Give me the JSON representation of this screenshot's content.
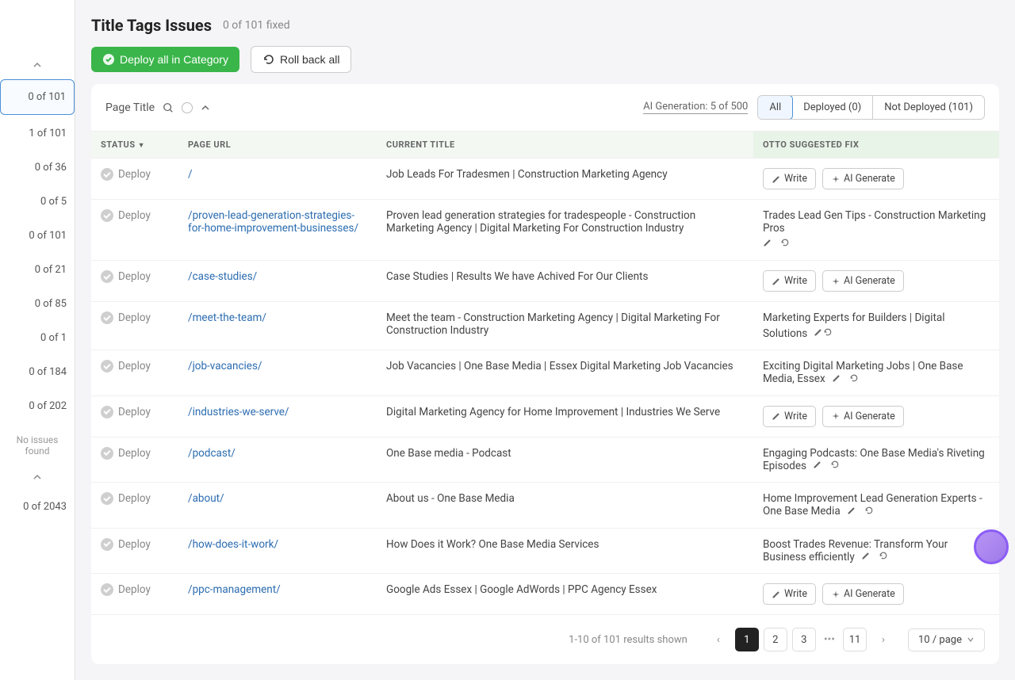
{
  "header": {
    "title": "Title Tags Issues",
    "fixed_text": "0 of 101 fixed",
    "deploy_all": "Deploy all in Category",
    "rollback_all": "Roll back all"
  },
  "filters": {
    "page_title": "Page Title",
    "ai_generation": "AI Generation:  5  of  500",
    "tabs": {
      "all": "All",
      "deployed": "Deployed (0)",
      "not_deployed": "Not Deployed (101)"
    }
  },
  "sidebar": {
    "items": [
      "0 of 101",
      "1 of 101",
      "0 of 36",
      "0 of 5",
      "0 of 101",
      "0 of 21",
      "0 of 85",
      "0 of 1",
      "0 of 184",
      "0 of 202"
    ],
    "no_issues": "No issues found",
    "bottom": "0 of 2043"
  },
  "columns": {
    "status": "STATUS",
    "url": "PAGE URL",
    "current": "CURRENT TITLE",
    "fix": "OTTO SUGGESTED FIX"
  },
  "actions": {
    "write": "Write",
    "ai_generate": "AI Generate",
    "deploy": "Deploy"
  },
  "rows": [
    {
      "url": "/",
      "current": "Job Leads For Tradesmen | Construction Marketing Agency",
      "fix_type": "buttons"
    },
    {
      "url": "/proven-lead-generation-strategies-for-home-improvement-businesses/",
      "current": "Proven lead generation strategies for tradespeople - Construction Marketing Agency | Digital Marketing For Construction Industry",
      "fix_type": "text_below",
      "fix": "Trades Lead Gen Tips - Construction Marketing Pros"
    },
    {
      "url": "/case-studies/",
      "current": "Case Studies | Results We have Achived For Our Clients",
      "fix_type": "buttons"
    },
    {
      "url": "/meet-the-team/",
      "current": "Meet the team - Construction Marketing Agency | Digital Marketing For Construction Industry",
      "fix_type": "text_inline",
      "fix": "Marketing Experts for Builders | Digital Solutions"
    },
    {
      "url": "/job-vacancies/",
      "current": "Job Vacancies | One Base Media | Essex Digital Marketing Job Vacancies",
      "fix_type": "text_after",
      "fix": "Exciting Digital Marketing Jobs | One Base Media, Essex"
    },
    {
      "url": "/industries-we-serve/",
      "current": "Digital Marketing Agency for Home Improvement | Industries We Serve",
      "fix_type": "buttons"
    },
    {
      "url": "/podcast/",
      "current": "One Base media - Podcast",
      "fix_type": "text_after",
      "fix": "Engaging Podcasts: One Base Media's Riveting Episodes"
    },
    {
      "url": "/about/",
      "current": "About us - One Base Media",
      "fix_type": "text_after",
      "fix": "Home Improvement Lead Generation Experts - One Base Media"
    },
    {
      "url": "/how-does-it-work/",
      "current": "How Does it Work? One Base Media Services",
      "fix_type": "text_after",
      "fix": "Boost Trades Revenue: Transform Your Business efficiently"
    },
    {
      "url": "/ppc-management/",
      "current": "Google Ads Essex | Google AdWords | PPC Agency Essex",
      "fix_type": "buttons"
    }
  ],
  "pagination": {
    "results_text": "1-10 of 101 results shown",
    "pages": [
      "1",
      "2",
      "3",
      "11"
    ],
    "per_page": "10 / page"
  }
}
